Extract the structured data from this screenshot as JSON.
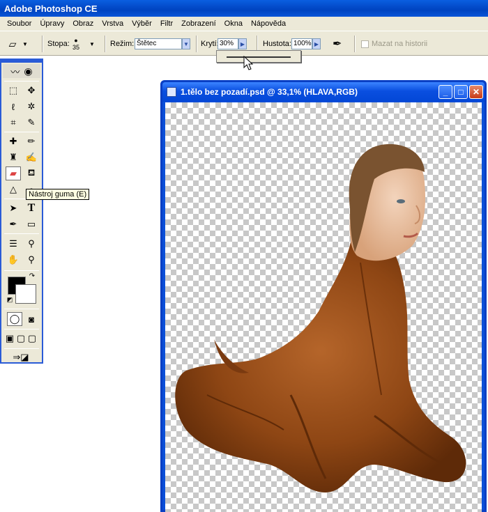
{
  "app": {
    "title": "Adobe Photoshop CE"
  },
  "menu": [
    "Soubor",
    "Úpravy",
    "Obraz",
    "Vrstva",
    "Výběr",
    "Filtr",
    "Zobrazení",
    "Okna",
    "Nápověda"
  ],
  "options": {
    "brush_label": "Stopa:",
    "brush_size": "35",
    "mode_label": "Režim:",
    "mode_value": "Štětec",
    "opacity_label": "Krytí:",
    "opacity_value": "30%",
    "density_label": "Hustota:",
    "density_value": "100%",
    "history_label": "Mazat na historii"
  },
  "tooltip": "Nástroj guma (E)",
  "document": {
    "title": "1.tělo bez pozadí.psd @ 33,1% (HLAVA,RGB)"
  },
  "colors": {
    "foreground": "#000000",
    "background": "#ffffff",
    "accent": "#0a4fe0"
  }
}
